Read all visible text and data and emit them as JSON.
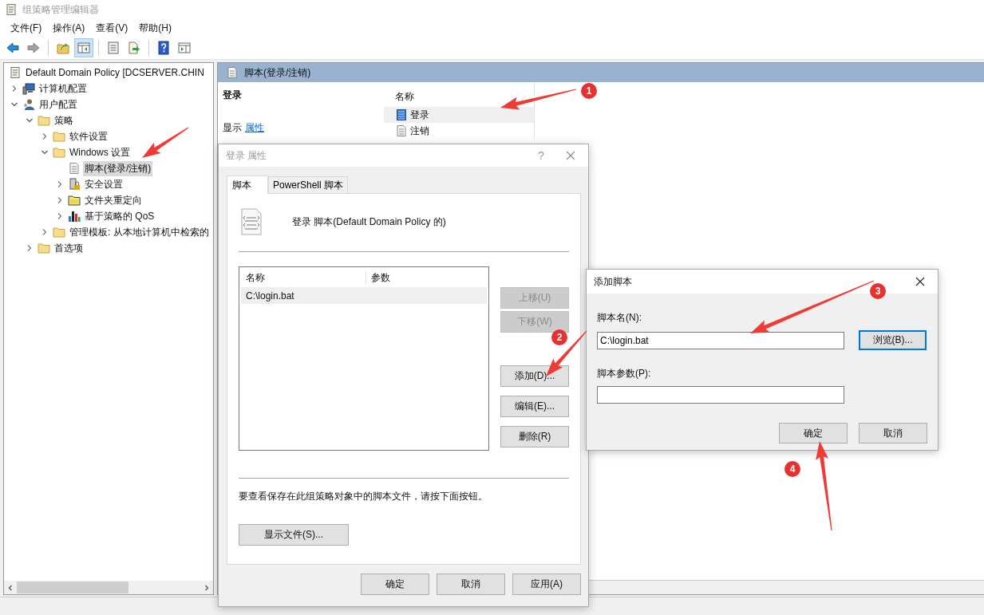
{
  "window": {
    "title": "组策略管理编辑器"
  },
  "menu": [
    "文件(F)",
    "操作(A)",
    "查看(V)",
    "帮助(H)"
  ],
  "toolbar": [
    {
      "kind": "back",
      "disabled": false,
      "pressed": false
    },
    {
      "kind": "forward",
      "disabled": true,
      "pressed": false
    },
    {
      "kind": "separator"
    },
    {
      "kind": "up",
      "disabled": false,
      "pressed": false
    },
    {
      "kind": "tree-toggle",
      "disabled": false,
      "pressed": true
    },
    {
      "kind": "separator"
    },
    {
      "kind": "properties",
      "disabled": false,
      "pressed": false
    },
    {
      "kind": "export",
      "disabled": false,
      "pressed": false
    },
    {
      "kind": "separator"
    },
    {
      "kind": "help",
      "disabled": false,
      "pressed": false
    },
    {
      "kind": "show-pane",
      "disabled": false,
      "pressed": false
    }
  ],
  "tree": {
    "label": "Default Domain Policy [DCSERVER.CHIN",
    "kind": "policy",
    "selected": false,
    "children": [
      {
        "label": "计算机配置",
        "kind": "computer",
        "expanded": false,
        "selected": false
      },
      {
        "label": "用户配置",
        "kind": "users",
        "expanded": true,
        "selected": false,
        "children": [
          {
            "label": "策略",
            "kind": "folder",
            "expanded": true,
            "selected": false,
            "children": [
              {
                "label": "软件设置",
                "kind": "folder",
                "expanded": false,
                "selected": false
              },
              {
                "label": "Windows 设置",
                "kind": "folder",
                "expanded": true,
                "selected": false,
                "children": [
                  {
                    "label": "脚本(登录/注销)",
                    "kind": "script",
                    "selected": true
                  },
                  {
                    "label": "安全设置",
                    "kind": "security",
                    "expanded": false,
                    "selected": false
                  },
                  {
                    "label": "文件夹重定向",
                    "kind": "folder-redirect",
                    "expanded": false,
                    "selected": false
                  },
                  {
                    "label": "基于策略的 QoS",
                    "kind": "qos",
                    "expanded": false,
                    "selected": false
                  }
                ]
              },
              {
                "label": "管理模板: 从本地计算机中检索的",
                "kind": "folder",
                "expanded": false,
                "selected": false
              }
            ]
          },
          {
            "label": "首选项",
            "kind": "folder",
            "expanded": false,
            "selected": false
          }
        ]
      }
    ]
  },
  "details": {
    "header": "脚本(登录/注销)",
    "heading": "登录",
    "show_label": "显示",
    "properties_link": "属性",
    "column": "名称",
    "items": [
      {
        "label": "登录",
        "selected": true
      },
      {
        "label": "注销",
        "selected": false
      }
    ]
  },
  "properties_dialog": {
    "title": "登录 属性",
    "active": false,
    "help_glyph": "?",
    "tabs": [
      {
        "label": "脚本",
        "selected": true
      },
      {
        "label": "PowerShell 脚本",
        "selected": false
      }
    ],
    "caption": "登录 脚本(Default Domain Policy 的)",
    "columns": [
      "名称",
      "参数"
    ],
    "rows": [
      {
        "name": "C:\\login.bat",
        "selected": true
      }
    ],
    "side_buttons": [
      {
        "label": "上移(U)",
        "disabled": true
      },
      {
        "label": "下移(W)",
        "disabled": true
      },
      {
        "label": "添加(D)...",
        "disabled": false
      },
      {
        "label": "编辑(E)...",
        "disabled": false
      },
      {
        "label": "删除(R)",
        "disabled": false
      }
    ],
    "note": "要查看保存在此组策略对象中的脚本文件，请按下面按钮。",
    "show_files_button": "显示文件(S)...",
    "buttons": [
      "确定",
      "取消",
      "应用(A)"
    ]
  },
  "add_script_dialog": {
    "title": "添加脚本",
    "active": true,
    "name_label": "脚本名(N):",
    "name_value": "C:\\login.bat",
    "params_label": "脚本参数(P):",
    "browse_button": {
      "label": "浏览(B)...",
      "focused": true
    },
    "buttons": [
      "确定",
      "取消"
    ]
  },
  "annotations": [
    {
      "kind": "arrow"
    },
    {
      "kind": "numbered",
      "label": "1"
    },
    {
      "kind": "numbered",
      "label": "2"
    },
    {
      "kind": "numbered",
      "label": "3"
    },
    {
      "kind": "numbered",
      "label": "4"
    }
  ]
}
